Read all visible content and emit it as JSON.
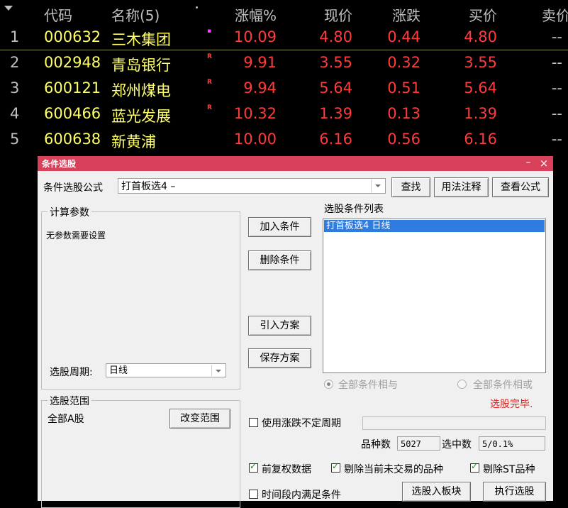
{
  "table": {
    "headers": {
      "code": "代码",
      "name": "名称(5)",
      "change_pct": "涨幅%",
      "price": "现价",
      "change": "涨跌",
      "bid": "买价",
      "ask": "卖价"
    },
    "rows": [
      {
        "index": "1",
        "code": "000632",
        "name": "三木集团",
        "flag": "▪",
        "change_pct": "10.09",
        "price": "4.80",
        "change": "0.44",
        "bid": "4.80",
        "ask": "--"
      },
      {
        "index": "2",
        "code": "002948",
        "name": "青岛银行",
        "flag": "R",
        "change_pct": "9.91",
        "price": "3.55",
        "change": "0.32",
        "bid": "3.55",
        "ask": "--"
      },
      {
        "index": "3",
        "code": "600121",
        "name": "郑州煤电",
        "flag": "R",
        "change_pct": "9.94",
        "price": "5.64",
        "change": "0.51",
        "bid": "5.64",
        "ask": "--"
      },
      {
        "index": "4",
        "code": "600466",
        "name": "蓝光发展",
        "flag": "R",
        "change_pct": "10.32",
        "price": "1.39",
        "change": "0.13",
        "bid": "1.39",
        "ask": "--"
      },
      {
        "index": "5",
        "code": "600638",
        "name": "新黄浦",
        "flag": "",
        "change_pct": "10.00",
        "price": "6.16",
        "change": "0.56",
        "bid": "6.16",
        "ask": "--"
      }
    ]
  },
  "dialog": {
    "title": "条件选股",
    "formula_label": "条件选股公式",
    "formula_value": "打首板选4        –",
    "find_button": "查找",
    "usage_button": "用法注释",
    "view_formula_button": "查看公式",
    "params_group_title": "计算参数",
    "params_text": "无参数需要设置",
    "period_label": "选股周期:",
    "period_value": "日线",
    "add_condition_button": "加入条件",
    "delete_condition_button": "删除条件",
    "import_scheme_button": "引入方案",
    "save_scheme_button": "保存方案",
    "condition_list_title": "选股条件列表",
    "condition_items": [
      "打首板选4    日线"
    ],
    "radio_and": "全部条件相与",
    "radio_or": "全部条件相或",
    "status_text": "选股完毕.",
    "range_group_title": "选股范围",
    "range_value": "全部A股",
    "change_range_button": "改变范围",
    "use_variable_period_label": "使用涨跌不定周期",
    "count_label": "品种数",
    "count_value": "5027",
    "selected_label": "选中数",
    "selected_value": "5/0.1%",
    "adjusted_data_label": "前复权数据",
    "exclude_untraded_label": "剔除当前未交易的品种",
    "exclude_st_label": "剔除ST品种",
    "time_range_label": "时间段内满足条件",
    "select_to_board_button": "选股入板块",
    "execute_button": "执行选股"
  },
  "colors": {
    "title_bar": "#d9405a",
    "up_red": "#ff3b3b",
    "code_yellow": "#ffff66",
    "status_red": "#e02020",
    "selection_blue": "#2e7ce0"
  }
}
